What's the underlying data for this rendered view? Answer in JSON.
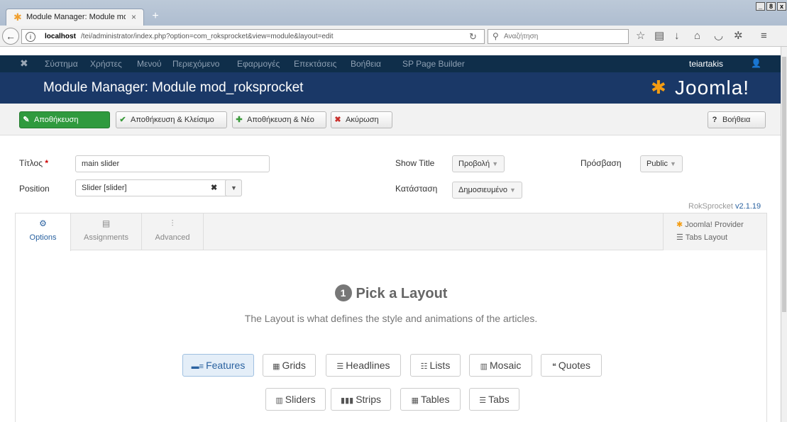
{
  "browser": {
    "tab_title": "Module Manager: Module mod_r",
    "tab_close": "×",
    "new_tab": "+",
    "url_host": "localhost",
    "url_path": "/tei/administrator/index.php?option=com_roksprocket&view=module&layout=edit",
    "search_placeholder": "Αναζήτηση",
    "window_controls": [
      "_",
      "8",
      "x"
    ]
  },
  "joomla_menu": {
    "items": [
      "Σύστημα",
      "Χρήστες",
      "Μενού",
      "Περιεχόμενο",
      "Εφαρμογές",
      "Επεκτάσεις",
      "Βοήθεια",
      "SP Page Builder"
    ],
    "user": "teiartakis"
  },
  "header": {
    "title": "Module Manager: Module mod_roksprocket",
    "brand": "Joomla!"
  },
  "toolbar": {
    "save": "Αποθήκευση",
    "save_close": "Αποθήκευση & Κλείσιμο",
    "save_new": "Αποθήκευση & Νέο",
    "cancel": "Ακύρωση",
    "help": "Βοήθεια"
  },
  "form": {
    "title_label": "Τίτλος",
    "title_required": "*",
    "title_value": "main slider",
    "position_label": "Position",
    "position_value": "Slider [slider]",
    "show_title_label": "Show Title",
    "show_title_value": "Προβολή",
    "status_label": "Κατάσταση",
    "status_value": "Δημοσιευμένο",
    "access_label": "Πρόσβαση",
    "access_value": "Public"
  },
  "version": {
    "prefix": "RokSprocket",
    "number": "v2.1.19"
  },
  "tabs": [
    {
      "label": "Options",
      "icon": "gear-icon"
    },
    {
      "label": "Assignments",
      "icon": "list-icon"
    },
    {
      "label": "Advanced",
      "icon": "sliders-icon"
    }
  ],
  "provider": {
    "provider_label": "Joomla! Provider",
    "layout_label": "Tabs Layout"
  },
  "pick": {
    "step": "1",
    "heading": "Pick a Layout",
    "subtext": "The Layout is what defines the style and animations of the articles."
  },
  "layouts_row1": [
    "Features",
    "Grids",
    "Headlines",
    "Lists",
    "Mosaic",
    "Quotes"
  ],
  "layouts_row2": [
    "Sliders",
    "Strips",
    "Tables",
    "Tabs"
  ],
  "selected_layout": "Features",
  "colors": {
    "menu_bg": "#0f2e4a",
    "header_bg": "#1a3867",
    "save_green": "#2f9a3e",
    "accent_blue": "#2a62a0"
  }
}
